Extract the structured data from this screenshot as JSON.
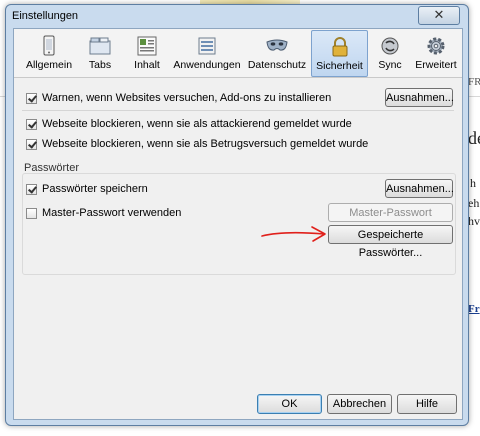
{
  "background": {
    "frag_fr": "FR",
    "frag_de": "de",
    "frag_h": "h",
    "frag_eh": "eh",
    "frag_hv": "hv",
    "frag_fr2": "Fr"
  },
  "window": {
    "title": "Einstellungen",
    "close_glyph": "✕"
  },
  "tabs": [
    {
      "label": "Allgemein",
      "icon": "phone-icon"
    },
    {
      "label": "Tabs",
      "icon": "tabs-icon"
    },
    {
      "label": "Inhalt",
      "icon": "content-icon"
    },
    {
      "label": "Anwendungen",
      "icon": "applications-icon"
    },
    {
      "label": "Datenschutz",
      "icon": "mask-icon"
    },
    {
      "label": "Sicherheit",
      "icon": "lock-icon",
      "active": true
    },
    {
      "label": "Sync",
      "icon": "sync-icon"
    },
    {
      "label": "Erweitert",
      "icon": "gear-icon"
    }
  ],
  "security": {
    "warn_addons": {
      "label": "Warnen, wenn Websites versuchen, Add-ons zu installieren",
      "checked": true
    },
    "exceptions_button": "Ausnahmen...",
    "block_attack": {
      "label": "Webseite blockieren, wenn sie als attackierend gemeldet wurde",
      "checked": true
    },
    "block_fraud": {
      "label": "Webseite blockieren, wenn sie als Betrugsversuch gemeldet wurde",
      "checked": true
    }
  },
  "passwords": {
    "group_label": "Passwörter",
    "save_passwords": {
      "label": "Passwörter speichern",
      "checked": true
    },
    "exceptions_button": "Ausnahmen...",
    "master_password": {
      "label": "Master-Passwort verwenden",
      "checked": false
    },
    "change_master_button": "Master-Passwort ändern...",
    "saved_passwords_button": "Gespeicherte Passwörter..."
  },
  "footer": {
    "ok": "OK",
    "cancel": "Abbrechen",
    "help": "Hilfe"
  },
  "colors": {
    "annotation_arrow": "#e0201b",
    "active_tab": "#bfd6f0"
  }
}
